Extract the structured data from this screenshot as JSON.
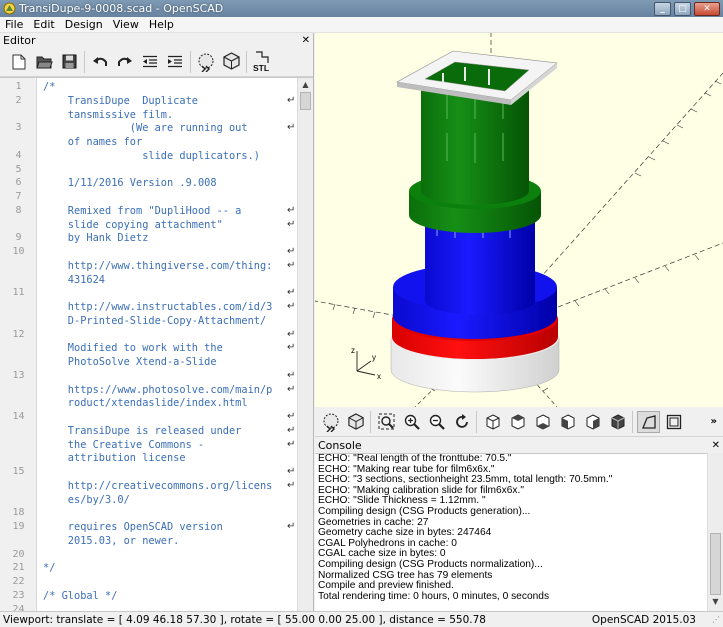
{
  "window": {
    "title": "TransiDupe-9-0008.scad - OpenSCAD"
  },
  "menu": [
    "File",
    "Edit",
    "Design",
    "View",
    "Help"
  ],
  "editor": {
    "label": "Editor",
    "lines": [
      {
        "n": "1",
        "t": "/*",
        "w": false
      },
      {
        "n": "2",
        "t": "    TransiDupe  Duplicate",
        "w": true
      },
      {
        "n": "",
        "t": "    tansmissive film.",
        "w": false
      },
      {
        "n": "3",
        "t": "              (We are running out",
        "w": true
      },
      {
        "n": "",
        "t": "    of names for",
        "w": false
      },
      {
        "n": "4",
        "t": "                slide duplicators.)",
        "w": false
      },
      {
        "n": "5",
        "t": "",
        "w": false
      },
      {
        "n": "6",
        "t": "    1/11/2016 Version .9.008",
        "w": false
      },
      {
        "n": "7",
        "t": "",
        "w": false
      },
      {
        "n": "8",
        "t": "    Remixed from \"DupliHood -- a",
        "w": true
      },
      {
        "n": "",
        "t": "    slide copying attachment\"",
        "w": true
      },
      {
        "n": "9",
        "t": "    by Hank Dietz",
        "w": false
      },
      {
        "n": "10",
        "t": "",
        "w": true
      },
      {
        "n": "",
        "t": "    http://www.thingiverse.com/thing:",
        "w": true
      },
      {
        "n": "",
        "t": "    431624",
        "w": false
      },
      {
        "n": "11",
        "t": "",
        "w": true
      },
      {
        "n": "",
        "t": "    http://www.instructables.com/id/3",
        "w": true
      },
      {
        "n": "",
        "t": "    D-Printed-Slide-Copy-Attachment/",
        "w": false
      },
      {
        "n": "12",
        "t": "",
        "w": true
      },
      {
        "n": "",
        "t": "    Modified to work with the",
        "w": true
      },
      {
        "n": "",
        "t": "    PhotoSolve Xtend-a-Slide",
        "w": false
      },
      {
        "n": "13",
        "t": "",
        "w": true
      },
      {
        "n": "",
        "t": "    https://www.photosolve.com/main/p",
        "w": true
      },
      {
        "n": "",
        "t": "    roduct/xtendaslide/index.html",
        "w": false
      },
      {
        "n": "14",
        "t": "",
        "w": true
      },
      {
        "n": "",
        "t": "    TransiDupe is released under",
        "w": true
      },
      {
        "n": "",
        "t": "    the Creative Commons -",
        "w": true
      },
      {
        "n": "",
        "t": "    attribution license",
        "w": false
      },
      {
        "n": "15",
        "t": "",
        "w": true
      },
      {
        "n": "",
        "t": "    http://creativecommons.org/licens",
        "w": true
      },
      {
        "n": "",
        "t": "    es/by/3.0/",
        "w": false
      },
      {
        "n": "18",
        "t": "",
        "w": false
      },
      {
        "n": "19",
        "t": "    requires OpenSCAD version",
        "w": true
      },
      {
        "n": "",
        "t": "    2015.03, or newer.",
        "w": false
      },
      {
        "n": "20",
        "t": "",
        "w": false
      },
      {
        "n": "21",
        "t": "*/",
        "w": false
      },
      {
        "n": "22",
        "t": "",
        "w": false
      },
      {
        "n": "23",
        "t": "/* Global */",
        "w": false
      },
      {
        "n": "24",
        "t": "",
        "w": false
      }
    ]
  },
  "console": {
    "label": "Console",
    "lines": [
      "ECHO: \"Real length of the fronttube: 70.5.\"",
      "ECHO: \"Making rear tube for film6x6x.\"",
      "ECHO: \"3 sections, sectionheight 23.5mm, total length: 70.5mm.\"",
      "ECHO: \"Making calibration slide for film6x6x.\"",
      "ECHO: \"Slide Thickness = 1.12mm. \"",
      "Compiling design (CSG Products generation)...",
      "Geometries in cache: 27",
      "Geometry cache size in bytes: 247464",
      "CGAL Polyhedrons in cache: 0",
      "CGAL cache size in bytes: 0",
      "Compiling design (CSG Products normalization)...",
      "Normalized CSG tree has 79 elements",
      "Compile and preview finished.",
      "Total rendering time: 0 hours, 0 minutes, 0 seconds"
    ]
  },
  "statusbar": {
    "viewport": "Viewport: translate = [ 4.09 46.18 57.30 ], rotate = [ 55.00 0.00 25.00 ], distance = 550.78",
    "version": "OpenSCAD 2015.03"
  },
  "toolbar": {
    "stl_label": "STL"
  },
  "axes": {
    "x": "x",
    "y": "y",
    "z": "z"
  },
  "icons": {
    "editor": [
      "new-file-icon",
      "open-folder-icon",
      "save-disk-icon",
      "undo-icon",
      "redo-icon",
      "unindent-icon",
      "indent-icon",
      "preview-icon",
      "render-icon",
      "export-stl-icon"
    ],
    "view": [
      "preview-icon",
      "render-icon",
      "view-all-icon",
      "zoom-in-icon",
      "zoom-out-icon",
      "reset-view-icon",
      "view-front-icon",
      "view-top-icon",
      "view-bottom-icon",
      "view-left-icon",
      "view-right-icon",
      "view-back-icon",
      "perspective-icon",
      "orthogonal-icon"
    ]
  },
  "colors": {
    "title_bar": "#7f9ab4",
    "viewport_bg": "#ffffe5",
    "code_text": "#3b6fb6",
    "model_green": "#008000",
    "model_blue": "#0000ff",
    "model_red": "#ff0000",
    "model_white": "#f5f5f5"
  }
}
